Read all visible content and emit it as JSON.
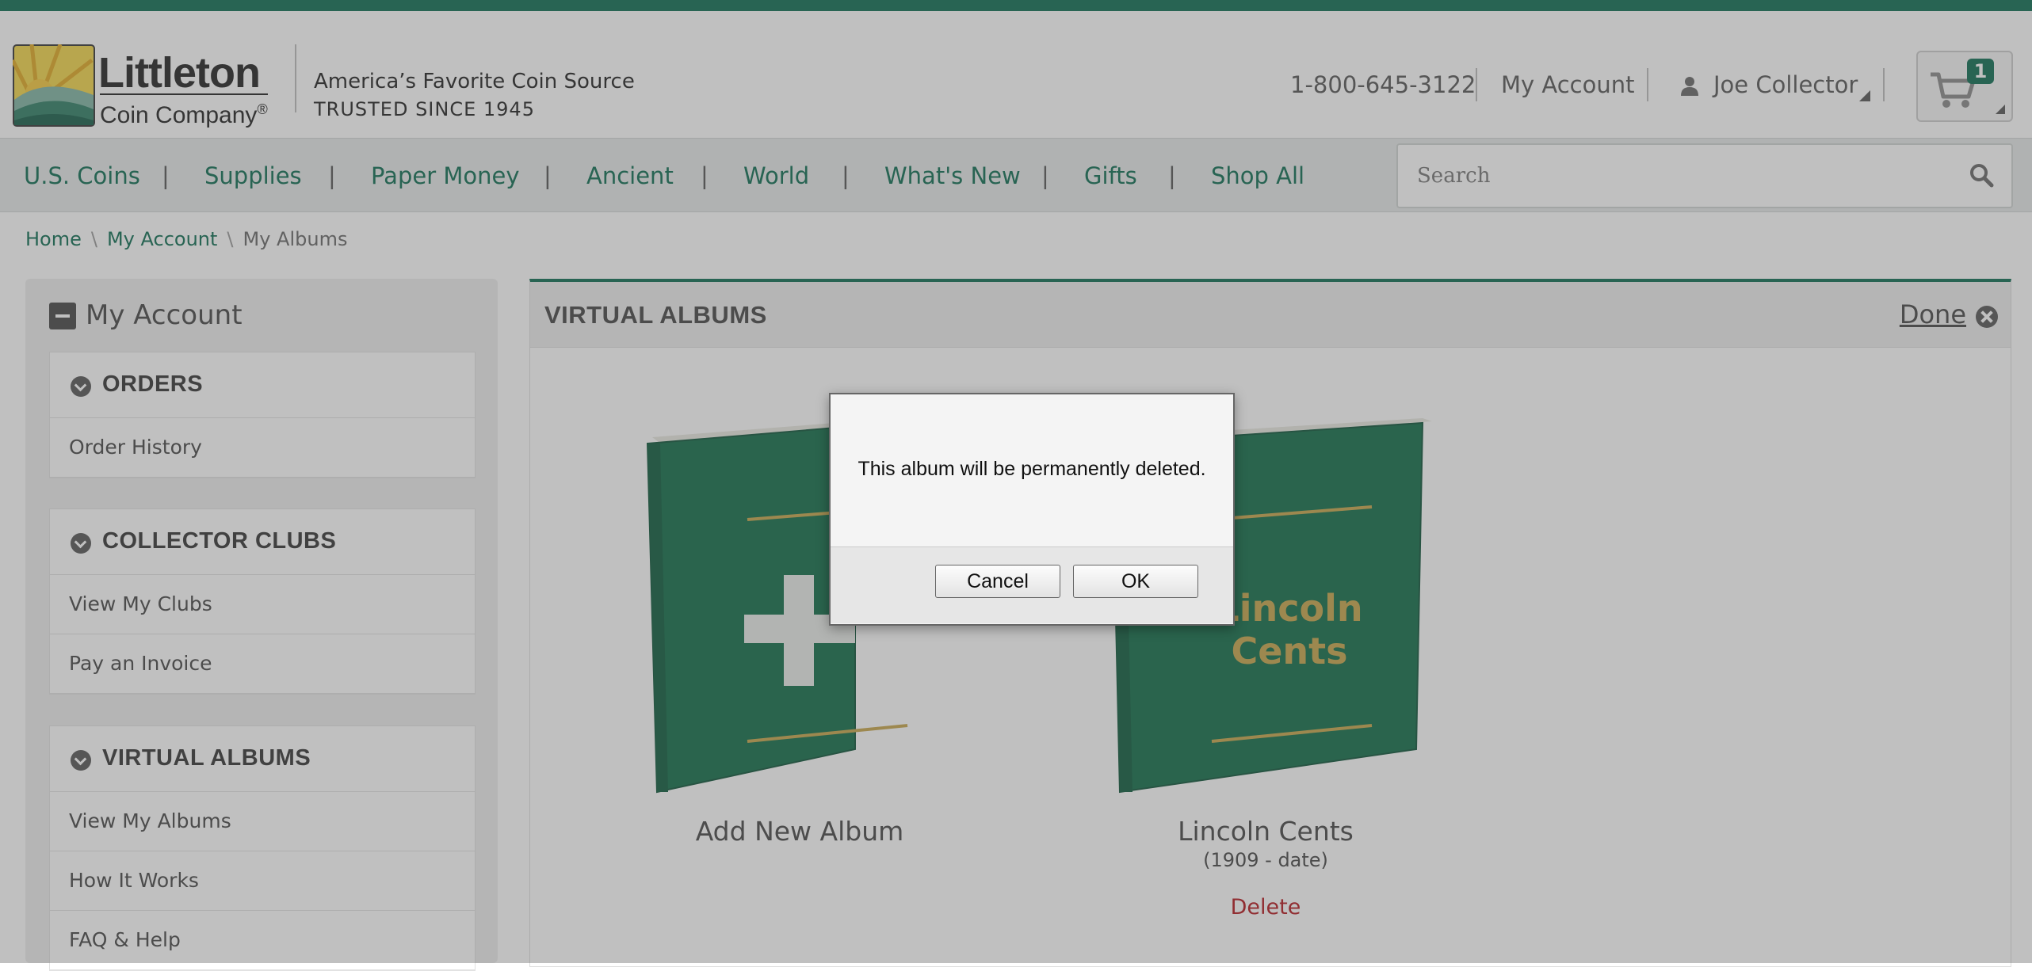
{
  "header": {
    "logo": {
      "name": "Littleton",
      "subname": "Coin Company",
      "registered": "®"
    },
    "tagline1": "America’s Favorite Coin Source",
    "tagline2": "TRUSTED SINCE 1945",
    "phone": "1-800-645-3122",
    "my_account": "My Account",
    "user_name": "Joe Collector",
    "cart_count": "1",
    "icons": {
      "user": "user-icon",
      "cart": "cart-icon",
      "search": "search-icon"
    }
  },
  "nav": {
    "items": [
      "U.S. Coins",
      "Supplies",
      "Paper Money",
      "Ancient",
      "World",
      "What's New",
      "Gifts",
      "Shop All"
    ],
    "separator": "|",
    "search_placeholder": "Search"
  },
  "breadcrumb": {
    "home": "Home",
    "account": "My Account",
    "current": "My Albums",
    "sep": "\\"
  },
  "sidebar": {
    "title": "My Account",
    "sections": [
      {
        "heading": "ORDERS",
        "items": [
          "Order History"
        ]
      },
      {
        "heading": "COLLECTOR CLUBS",
        "items": [
          "View My Clubs",
          "Pay an Invoice"
        ]
      },
      {
        "heading": "VIRTUAL ALBUMS",
        "items": [
          "View My Albums",
          "How It Works",
          "FAQ & Help"
        ]
      }
    ]
  },
  "main": {
    "title": "VIRTUAL ALBUMS",
    "done_label": "Done",
    "albums": [
      {
        "label": "Add New Album",
        "cover_text": "+"
      },
      {
        "label": "Lincoln Cents",
        "sub": "(1909 - date)",
        "cover_line1": "Lincoln",
        "cover_line2": "Cents",
        "delete_label": "Delete"
      }
    ]
  },
  "dialog": {
    "message": "This album will be permanently deleted.",
    "cancel_label": "Cancel",
    "ok_label": "OK"
  },
  "colors": {
    "brand": "#0b6b4f",
    "delete": "#b3141b",
    "album_green": "#0e6b46",
    "album_gold": "#c7a54a"
  }
}
